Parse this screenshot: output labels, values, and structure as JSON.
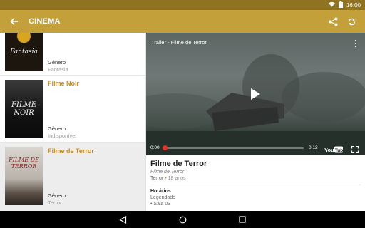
{
  "status": {
    "time": "16:00"
  },
  "appbar": {
    "title": "CINEMA"
  },
  "movies": [
    {
      "title": "",
      "poster_text": "Fantasia",
      "genre_label": "Gênero",
      "genre_value": "Fantasia"
    },
    {
      "title": "Filme Noir",
      "poster_text": "FILME NOIR",
      "genre_label": "Gênero",
      "genre_value": "Indisponível"
    },
    {
      "title": "Filme de Terror",
      "poster_text": "FILME DE TERROR",
      "genre_label": "Gênero",
      "genre_value": "Terror"
    }
  ],
  "player": {
    "title": "Trailer - Filme de Terror",
    "time_current": "0:00",
    "time_total": "0:12",
    "progress": 0.02,
    "brand": "YouTube"
  },
  "detail": {
    "title": "Filme de Terror",
    "subtitle": "Filme de Terror",
    "genre": "Terror",
    "rating": "18 anos",
    "schedule_heading": "Horários",
    "schedule_lines": [
      "Legendado",
      "• Sala 03"
    ]
  },
  "colors": {
    "appbar": "#c3a03a",
    "statusbar": "#8f7321",
    "accent": "#c48a28"
  }
}
